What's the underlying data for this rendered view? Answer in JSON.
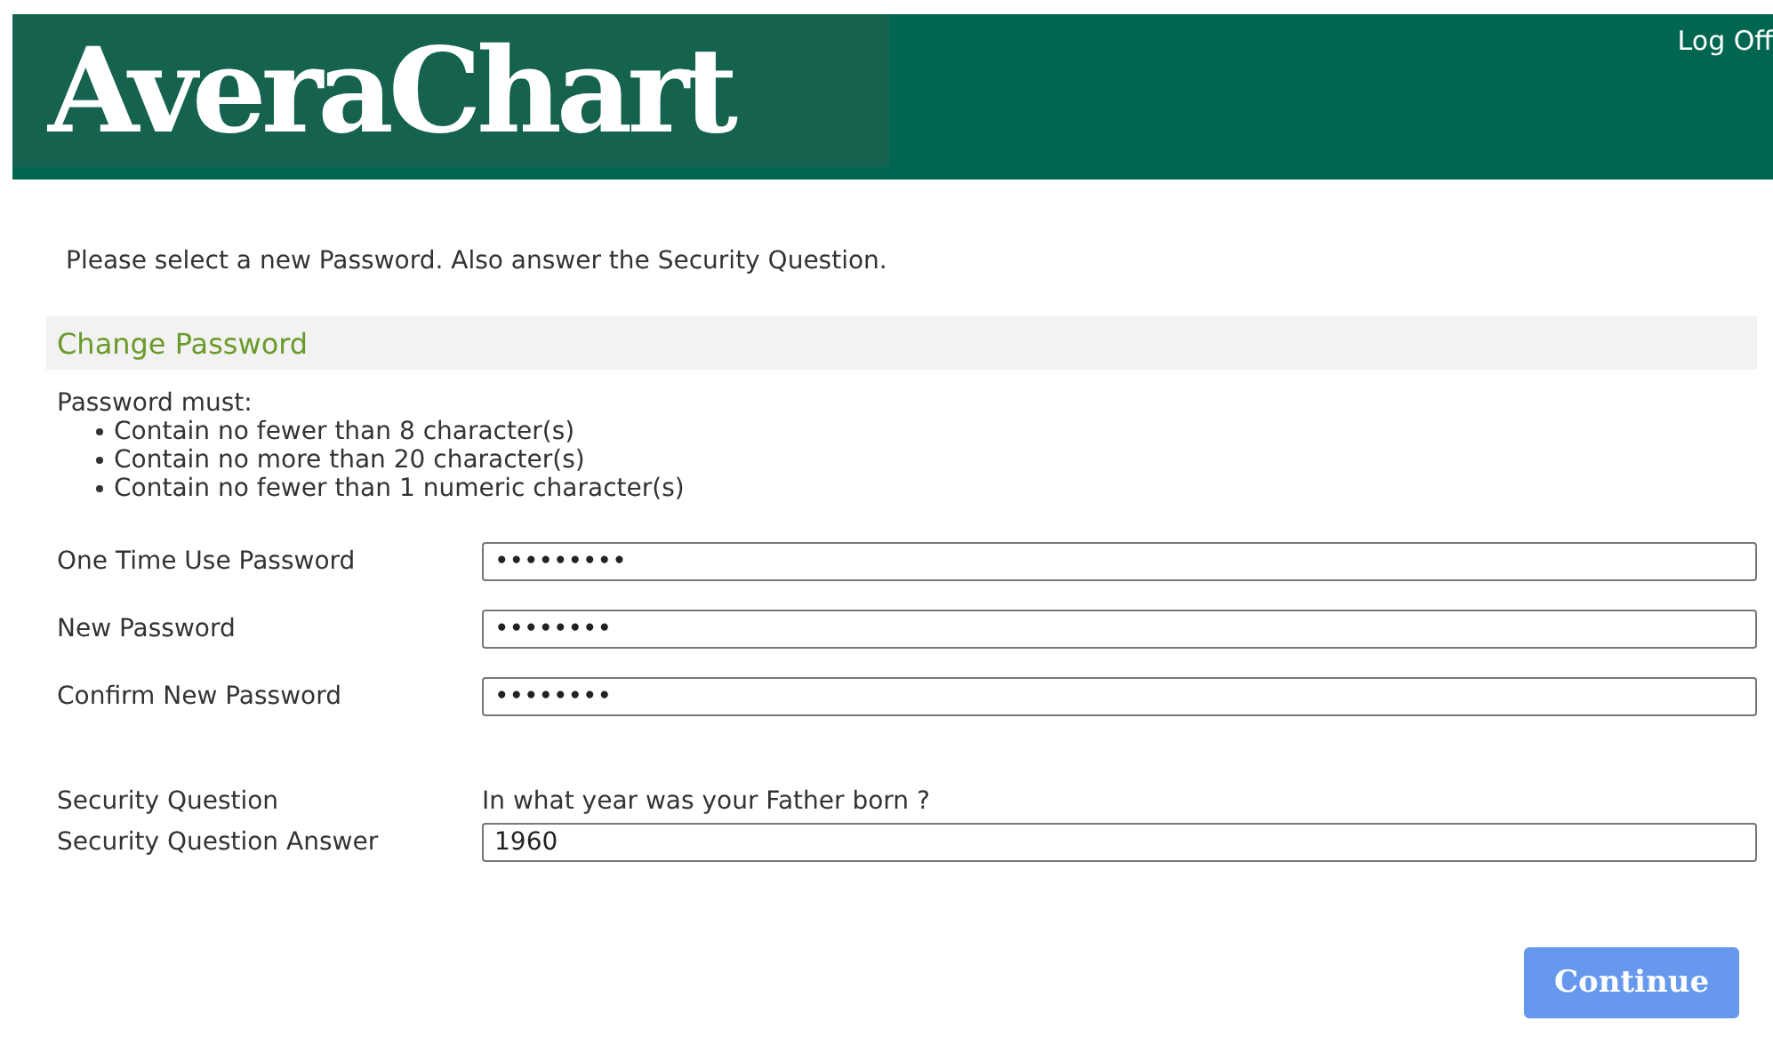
{
  "header": {
    "logo": "AveraChart",
    "logoff": "Log Off"
  },
  "intro": "Please select a new Password. Also answer the Security Question.",
  "section": {
    "title": "Change Password"
  },
  "rules": {
    "heading": "Password must:",
    "items": [
      "Contain no fewer than 8 character(s)",
      "Contain no more than 20 character(s)",
      "Contain no fewer than 1 numeric character(s)"
    ]
  },
  "password_fields": [
    {
      "label": "One Time Use Password",
      "value": "•••••••••"
    },
    {
      "label": "New Password",
      "value": "••••••••"
    },
    {
      "label": "Confirm New Password",
      "value": "••••••••"
    }
  ],
  "security": {
    "question_label": "Security Question",
    "question": "In what year was your Father born ?",
    "answer_label": "Security Question Answer",
    "answer": "1960"
  },
  "buttons": [
    "Continue"
  ]
}
